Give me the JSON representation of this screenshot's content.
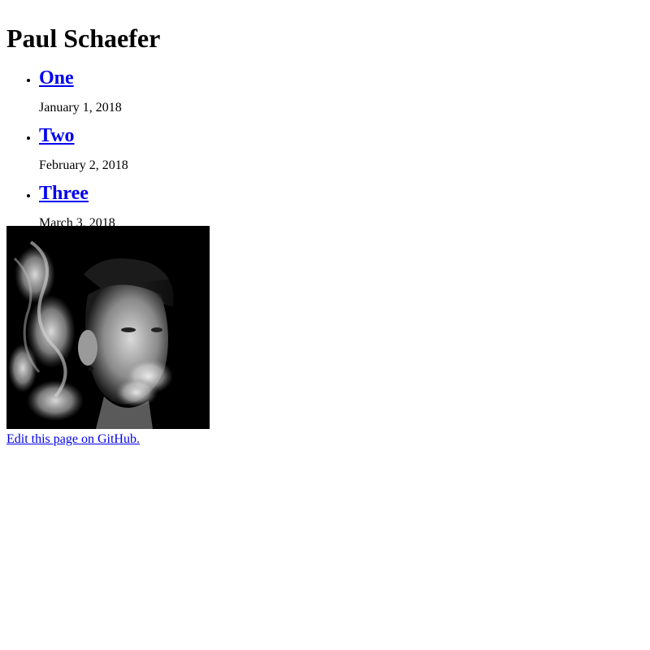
{
  "site": {
    "title": "Paul Schaefer"
  },
  "posts": [
    {
      "title": "One",
      "date": "January 1, 2018"
    },
    {
      "title": "Two",
      "date": "February 2, 2018"
    },
    {
      "title": "Three",
      "date": "March 3, 2018"
    }
  ],
  "photo": {
    "icon": "portrait-photo",
    "description_color_bg": "#000000"
  },
  "footer": {
    "edit_link": "Edit this page on GitHub."
  },
  "colors": {
    "link": "#0000ee",
    "text": "#000000",
    "background": "#ffffff"
  }
}
